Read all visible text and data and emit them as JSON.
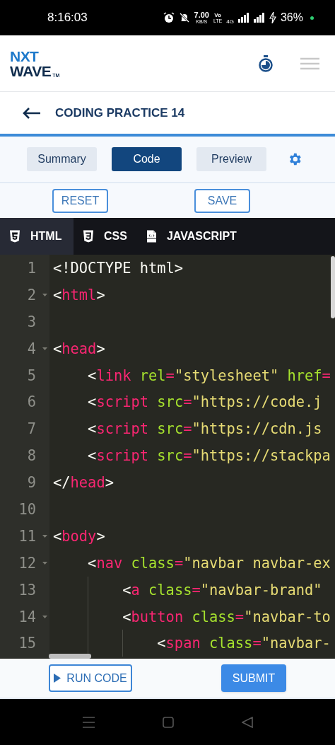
{
  "status_bar": {
    "time": "8:16:03",
    "speed": "7.00",
    "speed_unit": "KB/S",
    "volte_top": "Vo",
    "volte_bottom": "LTE",
    "network": "4G",
    "battery": "36%"
  },
  "header": {
    "logo_top": "NXT",
    "logo_bottom": "WAVE",
    "logo_mark": "TM"
  },
  "title": "CODING PRACTICE 14",
  "view_tabs": [
    {
      "label": "Summary",
      "selected": false
    },
    {
      "label": "Code",
      "selected": true
    },
    {
      "label": "Preview",
      "selected": false
    }
  ],
  "actions": [
    "RESET",
    "SAVE"
  ],
  "file_tabs": [
    {
      "label": "HTML",
      "kind": "html",
      "selected": true
    },
    {
      "label": "CSS",
      "kind": "css",
      "selected": false
    },
    {
      "label": "JAVASCRIPT",
      "kind": "js",
      "selected": false
    }
  ],
  "code_lines": [
    {
      "number": "1",
      "foldable": false,
      "tokens": [
        {
          "kind": "punct",
          "text": "<!DOCTYPE html>"
        }
      ]
    },
    {
      "number": "2",
      "foldable": true,
      "tokens": [
        {
          "kind": "punct",
          "text": "<"
        },
        {
          "kind": "tag",
          "text": "html"
        },
        {
          "kind": "punct",
          "text": ">"
        }
      ]
    },
    {
      "number": "3",
      "foldable": false
    },
    {
      "number": "4",
      "foldable": true,
      "tokens": [
        {
          "kind": "punct",
          "text": "<"
        },
        {
          "kind": "tag",
          "text": "head"
        },
        {
          "kind": "punct",
          "text": ">"
        }
      ]
    },
    {
      "number": "5",
      "foldable": false,
      "tokens": [
        {
          "kind": "punct",
          "text": "    <"
        },
        {
          "kind": "tag",
          "text": "link"
        },
        {
          "kind": "attr",
          "text": " rel"
        },
        {
          "kind": "operator",
          "text": "="
        },
        {
          "kind": "string",
          "text": "\"stylesheet\""
        },
        {
          "kind": "attr",
          "text": " href"
        },
        {
          "kind": "operator",
          "text": "="
        }
      ]
    },
    {
      "number": "6",
      "foldable": false,
      "tokens": [
        {
          "kind": "punct",
          "text": "    <"
        },
        {
          "kind": "tag",
          "text": "script"
        },
        {
          "kind": "attr",
          "text": " src"
        },
        {
          "kind": "operator",
          "text": "="
        },
        {
          "kind": "string",
          "text": "\"https://code.j"
        }
      ]
    },
    {
      "number": "7",
      "foldable": false,
      "tokens": [
        {
          "kind": "punct",
          "text": "    <"
        },
        {
          "kind": "tag",
          "text": "script"
        },
        {
          "kind": "attr",
          "text": " src"
        },
        {
          "kind": "operator",
          "text": "="
        },
        {
          "kind": "string",
          "text": "\"https://cdn.js"
        }
      ]
    },
    {
      "number": "8",
      "foldable": false,
      "tokens": [
        {
          "kind": "punct",
          "text": "    <"
        },
        {
          "kind": "tag",
          "text": "script"
        },
        {
          "kind": "attr",
          "text": " src"
        },
        {
          "kind": "operator",
          "text": "="
        },
        {
          "kind": "string",
          "text": "\"https://stackpa"
        }
      ]
    },
    {
      "number": "9",
      "foldable": false,
      "tokens": [
        {
          "kind": "punct",
          "text": "</"
        },
        {
          "kind": "tag",
          "text": "head"
        },
        {
          "kind": "punct",
          "text": ">"
        }
      ]
    },
    {
      "number": "10",
      "foldable": false
    },
    {
      "number": "11",
      "foldable": true,
      "tokens": [
        {
          "kind": "punct",
          "text": "<"
        },
        {
          "kind": "tag",
          "text": "body"
        },
        {
          "kind": "punct",
          "text": ">"
        }
      ]
    },
    {
      "number": "12",
      "foldable": true,
      "tokens": [
        {
          "kind": "punct",
          "text": "    <"
        },
        {
          "kind": "tag",
          "text": "nav"
        },
        {
          "kind": "attr",
          "text": " class"
        },
        {
          "kind": "operator",
          "text": "="
        },
        {
          "kind": "string",
          "text": "\"navbar navbar-ex"
        }
      ]
    },
    {
      "number": "13",
      "foldable": false,
      "tokens": [
        {
          "kind": "punct",
          "text": "        <"
        },
        {
          "kind": "tag",
          "text": "a"
        },
        {
          "kind": "attr",
          "text": " class"
        },
        {
          "kind": "operator",
          "text": "="
        },
        {
          "kind": "string",
          "text": "\"navbar-brand\""
        }
      ]
    },
    {
      "number": "14",
      "foldable": true,
      "tokens": [
        {
          "kind": "punct",
          "text": "        <"
        },
        {
          "kind": "tag",
          "text": "button"
        },
        {
          "kind": "attr",
          "text": " class"
        },
        {
          "kind": "operator",
          "text": "="
        },
        {
          "kind": "string",
          "text": "\"navbar-to"
        }
      ]
    },
    {
      "number": "15",
      "foldable": false,
      "tokens": [
        {
          "kind": "punct",
          "text": "            <"
        },
        {
          "kind": "tag",
          "text": "span"
        },
        {
          "kind": "attr",
          "text": " class"
        },
        {
          "kind": "operator",
          "text": "="
        },
        {
          "kind": "string",
          "text": "\"navbar-"
        }
      ]
    }
  ],
  "bottom_actions": {
    "run": "RUN CODE",
    "submit": "SUBMIT"
  }
}
